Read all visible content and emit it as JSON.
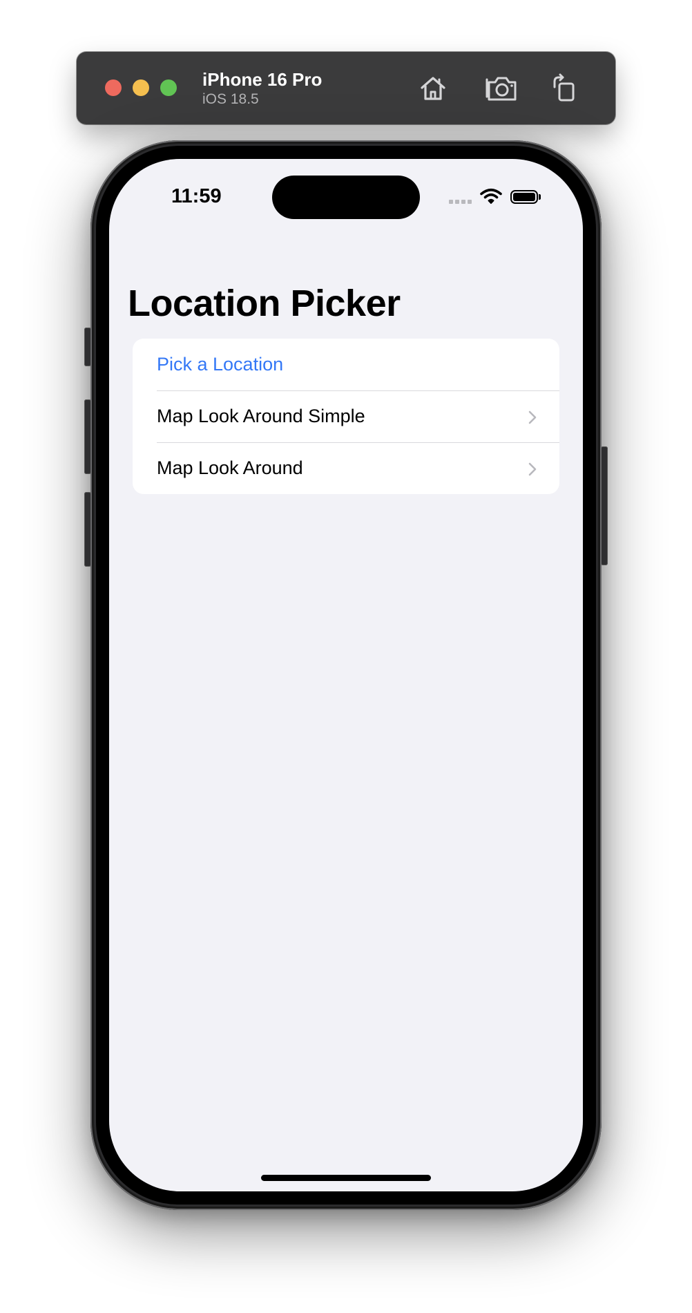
{
  "simulator": {
    "device_name": "iPhone 16 Pro",
    "os_version": "iOS 18.5",
    "toolbar_icons": [
      "home-icon",
      "screenshot-camera-icon",
      "rotate-icon"
    ]
  },
  "status_bar": {
    "time": "11:59",
    "icons": [
      "cellular-signal-icon",
      "wifi-icon",
      "battery-icon"
    ]
  },
  "screen": {
    "title": "Location Picker",
    "rows": [
      {
        "label": "Pick a Location",
        "style": "action",
        "color": "#3478f6"
      },
      {
        "label": "Map Look Around Simple",
        "style": "navigation",
        "chevron": "chevron-right-icon"
      },
      {
        "label": "Map Look Around",
        "style": "navigation",
        "chevron": "chevron-right-icon"
      }
    ]
  },
  "colors": {
    "background": "#f2f2f7",
    "card": "#ffffff",
    "accent": "#3478f6",
    "toolbar": "#3b3b3c"
  }
}
